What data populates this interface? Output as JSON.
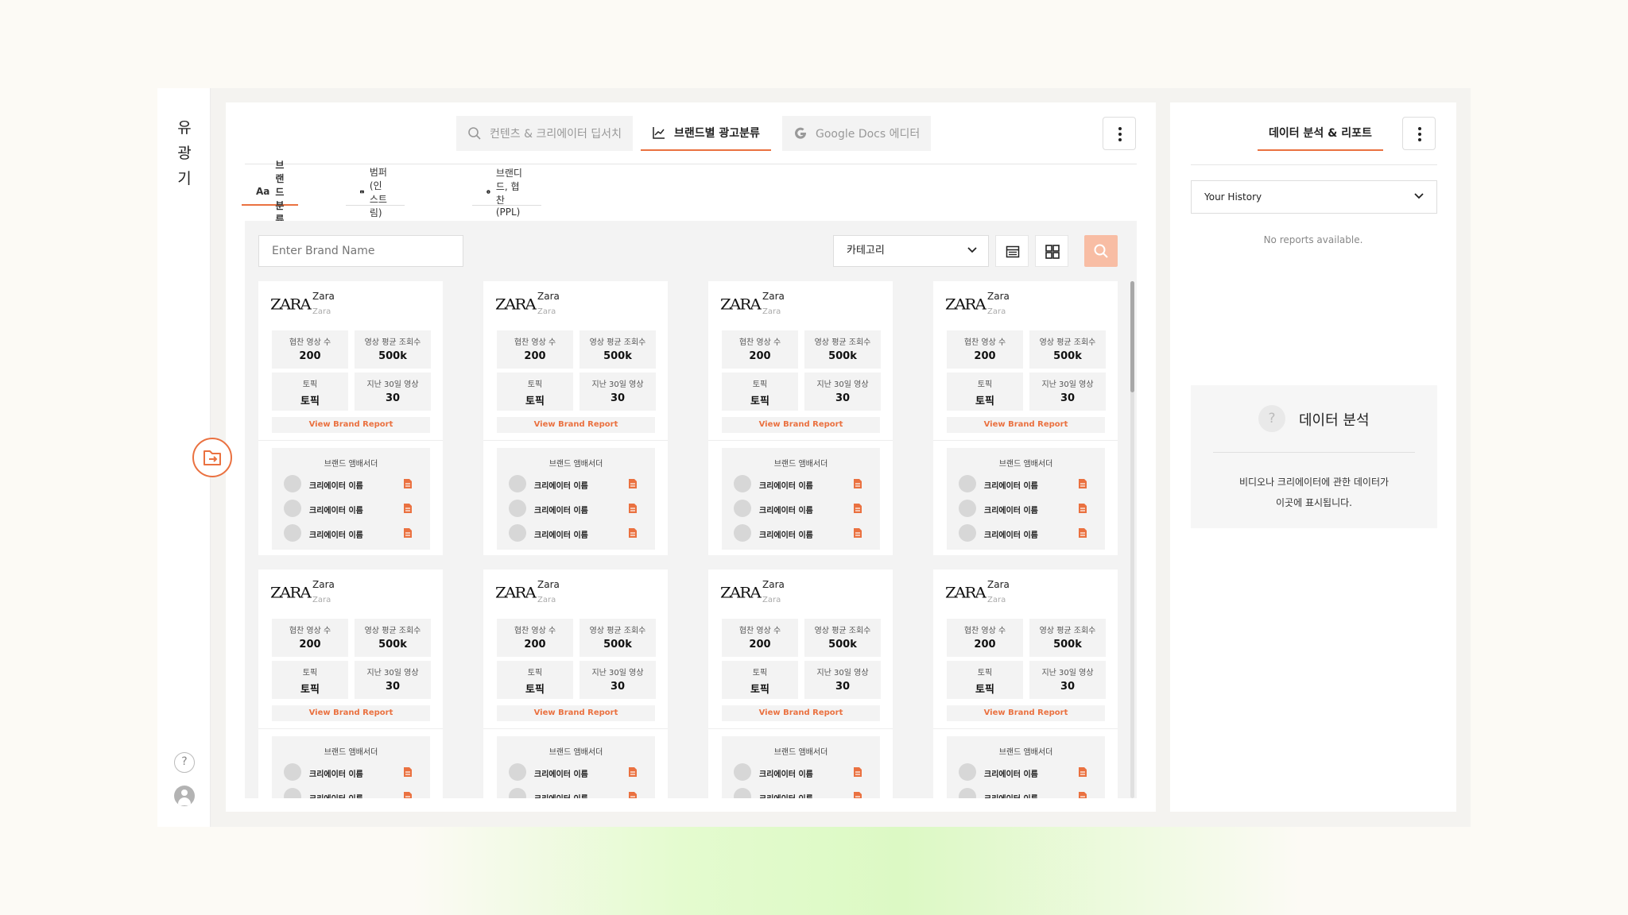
{
  "app": {
    "logo": [
      "유",
      "광",
      "기"
    ],
    "help_label": "?"
  },
  "top_tabs": [
    {
      "label": "컨텐츠 & 크리에이터 딥서치",
      "active": false,
      "icon": "search-icon"
    },
    {
      "label": "브랜드별 광고분류",
      "active": true,
      "icon": "chart-line-icon"
    },
    {
      "label": "Google Docs 에디터",
      "active": false,
      "icon": "google-icon"
    }
  ],
  "sub_tabs": [
    {
      "label": "브랜드 분류",
      "active": true,
      "icon": "text-aa-icon"
    },
    {
      "label": "범퍼 (인스트림)",
      "active": false,
      "icon": "ad-icon"
    },
    {
      "label": "브랜디드, 협찬(PPL)",
      "active": false,
      "icon": "coin-icon"
    }
  ],
  "filters": {
    "search_placeholder": "Enter Brand Name",
    "category_label": "카테고리"
  },
  "cards": [
    {
      "logo_text": "ZARA",
      "name": "Zara",
      "sub": "Zara",
      "stats": [
        {
          "label": "협찬 영상 수",
          "value": "200"
        },
        {
          "label": "영상 평균 조회수",
          "value": "500k"
        },
        {
          "label": "토픽",
          "value": "토픽"
        },
        {
          "label": "지난 30일 영상",
          "value": "30"
        }
      ],
      "report_label": "View Brand Report",
      "ambassador_title": "브랜드 앰배서더",
      "creators": [
        "크리에이터 이름",
        "크리에이터 이름",
        "크리에이터 이름"
      ]
    },
    {
      "logo_text": "ZARA",
      "name": "Zara",
      "sub": "Zara",
      "stats": [
        {
          "label": "협찬 영상 수",
          "value": "200"
        },
        {
          "label": "영상 평균 조회수",
          "value": "500k"
        },
        {
          "label": "토픽",
          "value": "토픽"
        },
        {
          "label": "지난 30일 영상",
          "value": "30"
        }
      ],
      "report_label": "View Brand Report",
      "ambassador_title": "브랜드 앰배서더",
      "creators": [
        "크리에이터 이름",
        "크리에이터 이름",
        "크리에이터 이름"
      ]
    },
    {
      "logo_text": "ZARA",
      "name": "Zara",
      "sub": "Zara",
      "stats": [
        {
          "label": "협찬 영상 수",
          "value": "200"
        },
        {
          "label": "영상 평균 조회수",
          "value": "500k"
        },
        {
          "label": "토픽",
          "value": "토픽"
        },
        {
          "label": "지난 30일 영상",
          "value": "30"
        }
      ],
      "report_label": "View Brand Report",
      "ambassador_title": "브랜드 앰배서더",
      "creators": [
        "크리에이터 이름",
        "크리에이터 이름",
        "크리에이터 이름"
      ]
    },
    {
      "logo_text": "ZARA",
      "name": "Zara",
      "sub": "Zara",
      "stats": [
        {
          "label": "협찬 영상 수",
          "value": "200"
        },
        {
          "label": "영상 평균 조회수",
          "value": "500k"
        },
        {
          "label": "토픽",
          "value": "토픽"
        },
        {
          "label": "지난 30일 영상",
          "value": "30"
        }
      ],
      "report_label": "View Brand Report",
      "ambassador_title": "브랜드 앰배서더",
      "creators": [
        "크리에이터 이름",
        "크리에이터 이름",
        "크리에이터 이름"
      ]
    },
    {
      "logo_text": "ZARA",
      "name": "Zara",
      "sub": "Zara",
      "stats": [
        {
          "label": "협찬 영상 수",
          "value": "200"
        },
        {
          "label": "영상 평균 조회수",
          "value": "500k"
        },
        {
          "label": "토픽",
          "value": "토픽"
        },
        {
          "label": "지난 30일 영상",
          "value": "30"
        }
      ],
      "report_label": "View Brand Report",
      "ambassador_title": "브랜드 앰배서더",
      "creators": [
        "크리에이터 이름",
        "크리에이터 이름"
      ]
    },
    {
      "logo_text": "ZARA",
      "name": "Zara",
      "sub": "Zara",
      "stats": [
        {
          "label": "협찬 영상 수",
          "value": "200"
        },
        {
          "label": "영상 평균 조회수",
          "value": "500k"
        },
        {
          "label": "토픽",
          "value": "토픽"
        },
        {
          "label": "지난 30일 영상",
          "value": "30"
        }
      ],
      "report_label": "View Brand Report",
      "ambassador_title": "브랜드 앰배서더",
      "creators": [
        "크리에이터 이름",
        "크리에이터 이름"
      ]
    },
    {
      "logo_text": "ZARA",
      "name": "Zara",
      "sub": "Zara",
      "stats": [
        {
          "label": "협찬 영상 수",
          "value": "200"
        },
        {
          "label": "영상 평균 조회수",
          "value": "500k"
        },
        {
          "label": "토픽",
          "value": "토픽"
        },
        {
          "label": "지난 30일 영상",
          "value": "30"
        }
      ],
      "report_label": "View Brand Report",
      "ambassador_title": "브랜드 앰배서더",
      "creators": [
        "크리에이터 이름",
        "크리에이터 이름"
      ]
    },
    {
      "logo_text": "ZARA",
      "name": "Zara",
      "sub": "Zara",
      "stats": [
        {
          "label": "협찬 영상 수",
          "value": "200"
        },
        {
          "label": "영상 평균 조회수",
          "value": "500k"
        },
        {
          "label": "토픽",
          "value": "토픽"
        },
        {
          "label": "지난 30일 영상",
          "value": "30"
        }
      ],
      "report_label": "View Brand Report",
      "ambassador_title": "브랜드 앰배서더",
      "creators": [
        "크리에이터 이름",
        "크리에이터 이름"
      ]
    }
  ],
  "side": {
    "tab_label": "데이터 분석 & 리포트",
    "history_label": "Your History",
    "no_reports": "No reports available.",
    "analysis_title": "데이터 분석",
    "analysis_desc_1": "비디오나 크리에이터에 관한 데이터가",
    "analysis_desc_2": "이곳에 표시됩니다.",
    "question_mark": "?"
  },
  "colors": {
    "accent": "#ea7140",
    "search_button": "#f8bda4",
    "background": "#fcfaf5"
  }
}
